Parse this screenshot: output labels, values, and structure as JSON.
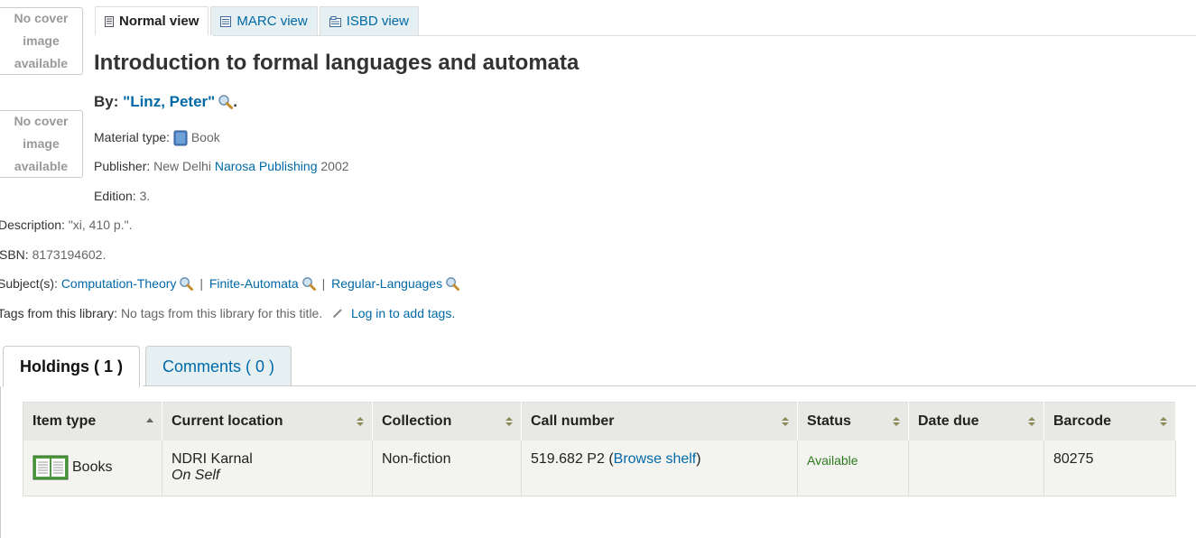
{
  "covers": {
    "top": [
      "No cover",
      "image",
      "available"
    ],
    "bottom": [
      "No cover",
      "image",
      "available"
    ]
  },
  "view_tabs": {
    "normal": "Normal view",
    "marc": "MARC view",
    "isbd": "ISBD view"
  },
  "record": {
    "title": "Introduction to formal languages and automata",
    "by_label": "By:",
    "author": "\"Linz, Peter\"",
    "author_end": ".",
    "material_type_label": "Material type:",
    "material_type": "Book",
    "publisher_label": "Publisher:",
    "publisher_place": "New Delhi",
    "publisher_name": "Narosa Publishing",
    "publisher_year": "2002",
    "edition_label": "Edition:",
    "edition": "3.",
    "description_label": "Description:",
    "description": "\"xi, 410 p.\".",
    "isbn_label": "SBN:",
    "isbn": "8173194602.",
    "subjects_label": "Subject(s):",
    "subjects": [
      "Computation-Theory",
      "Finite-Automata",
      "Regular-Languages"
    ],
    "subject_sep": "|",
    "tags_label": "Tags from this library:",
    "tags_text": "No tags from this library for this title.",
    "tags_login": "Log in to add tags."
  },
  "bottom_tabs": {
    "holdings": "Holdings ( 1 )",
    "comments": "Comments ( 0 )"
  },
  "holdings": {
    "headers": [
      "Item type",
      "Current location",
      "Collection",
      "Call number",
      "Status",
      "Date due",
      "Barcode"
    ],
    "rows": [
      {
        "item_type": "Books",
        "location": "NDRI Karnal",
        "sublocation": "On Self",
        "collection": "Non-fiction",
        "call_number": "519.682 P2",
        "call_open": "(",
        "browse_shelf": "Browse shelf",
        "call_close": ")",
        "status": "Available",
        "date_due": "",
        "barcode": "80275"
      }
    ]
  },
  "colors": {
    "link": "#0069a6",
    "available": "#2c7a1c",
    "header_bg": "#e8e8e4"
  }
}
